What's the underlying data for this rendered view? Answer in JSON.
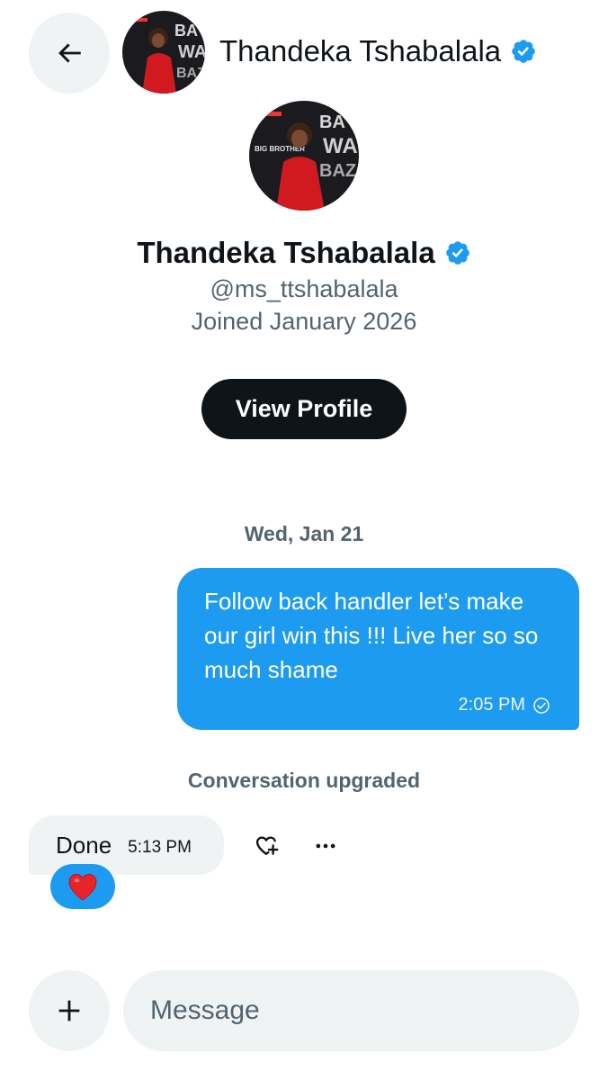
{
  "header": {
    "title": "Thandeka Tshabalala",
    "verified": true
  },
  "profile": {
    "name": "Thandeka Tshabalala",
    "handle": "@ms_ttshabalala",
    "joined": "Joined January 2026",
    "view_profile_label": "View Profile"
  },
  "conversation": {
    "date_separator": "Wed, Jan 21",
    "sent_message": {
      "text": "Follow back handler let’s make our girl win this !!! Live her so so much shame",
      "time": "2:05 PM",
      "status": "read"
    },
    "system_notice": "Conversation upgraded",
    "received_message": {
      "text": "Done",
      "time": "5:13 PM",
      "reaction": "red-heart"
    }
  },
  "composer": {
    "placeholder": "Message"
  },
  "icons": {
    "back": "arrow-left-icon",
    "verified": "verified-badge-icon",
    "react": "heart-plus-icon",
    "more": "more-horizontal-icon",
    "add": "plus-icon",
    "read_receipt": "check-circle-icon"
  },
  "colors": {
    "accent": "#1d9bf0",
    "text_primary": "#0f1419",
    "text_secondary": "#536471",
    "bubble_received": "#eff3f4",
    "heart": "#f91880"
  }
}
